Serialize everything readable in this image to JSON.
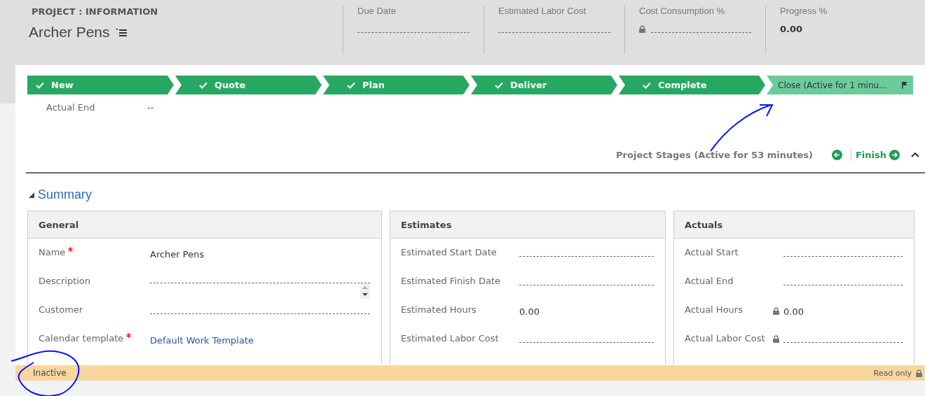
{
  "header": {
    "entity": "PROJECT : INFORMATION",
    "title": "Archer Pens",
    "metrics": [
      {
        "label": "Due Date",
        "locked": false
      },
      {
        "label": "Estimated Labor Cost",
        "locked": false
      },
      {
        "label": "Cost Consumption %",
        "locked": true
      },
      {
        "label": "Progress %",
        "value": "0.00",
        "locked": false
      }
    ]
  },
  "stages": [
    {
      "label": "New",
      "completed": true,
      "active": false
    },
    {
      "label": "Quote",
      "completed": true,
      "active": false
    },
    {
      "label": "Plan",
      "completed": true,
      "active": false
    },
    {
      "label": "Deliver",
      "completed": true,
      "active": false
    },
    {
      "label": "Complete",
      "completed": true,
      "active": false
    },
    {
      "label": "Close (Active for 1 minu…",
      "completed": false,
      "active": true
    }
  ],
  "stage_field": {
    "label": "Actual End",
    "value": "--"
  },
  "process": {
    "status": "Project Stages (Active for 53 minutes)",
    "next": "Finish"
  },
  "section": {
    "title": "Summary",
    "expanded": true,
    "cards": [
      {
        "title": "General",
        "fields": [
          {
            "label": "Name",
            "required": true,
            "kind": "text",
            "value": "Archer Pens"
          },
          {
            "label": "Description",
            "required": false,
            "kind": "textarea"
          },
          {
            "label": "Customer",
            "required": false,
            "kind": "empty"
          },
          {
            "label": "Calendar template",
            "required": true,
            "kind": "link",
            "value": "Default Work Template"
          }
        ]
      },
      {
        "title": "Estimates",
        "fields": [
          {
            "label": "Estimated Start Date",
            "required": false,
            "kind": "empty"
          },
          {
            "label": "Estimated Finish Date",
            "required": false,
            "kind": "empty"
          },
          {
            "label": "Estimated Hours",
            "required": false,
            "kind": "text",
            "value": "0.00"
          },
          {
            "label": "Estimated Labor Cost",
            "required": false,
            "kind": "empty"
          }
        ]
      },
      {
        "title": "Actuals",
        "fields": [
          {
            "label": "Actual Start",
            "required": false,
            "kind": "empty"
          },
          {
            "label": "Actual End",
            "required": false,
            "kind": "empty"
          },
          {
            "label": "Actual Hours",
            "required": false,
            "kind": "text",
            "value": "0.00",
            "locked": true
          },
          {
            "label": "Actual Labor Cost",
            "required": false,
            "kind": "empty",
            "locked": true
          }
        ]
      }
    ]
  },
  "status_bar": {
    "state": "Inactive",
    "mode": "Read only",
    "locked": true
  }
}
